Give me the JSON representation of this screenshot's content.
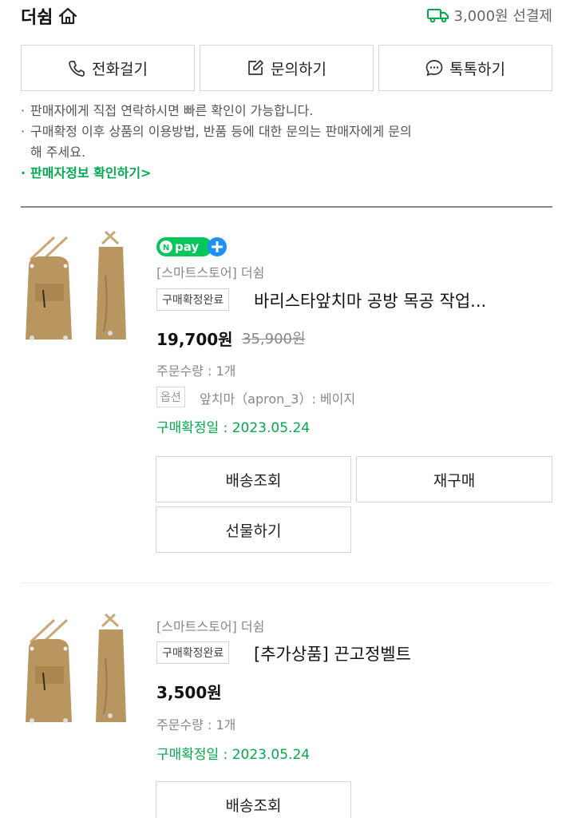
{
  "store": {
    "name": "더쉼",
    "shipping_text": "3,000원 선결제"
  },
  "contact": {
    "call_label": "전화걸기",
    "inquiry_label": "문의하기",
    "talk_label": "톡톡하기"
  },
  "notice": {
    "line1": "판매자에게 직접 연락하시면 빠른 확인이 가능합니다.",
    "line2a": "구매확정 이후 상품의 이용방법, 반품 등에 대한 문의는 판매자에게 문의",
    "line2b": "해 주세요.",
    "seller_info_link": "판매자정보 확인하기>"
  },
  "orders": [
    {
      "pay_badge": "Npay+",
      "store_tag": "[스마트스토어] 더쉼",
      "status": "구매확정완료",
      "title": "바리스타앞치마 공방 목공 작업...",
      "price": "19,700원",
      "original_price": "35,900원",
      "quantity": "주문수량 : 1개",
      "option_label": "옵션",
      "option_value": "앞치마（apron_3）: 베이지",
      "confirm_date": "구매확정일 : 2023.05.24",
      "buttons": {
        "track": "배송조회",
        "rebuy": "재구매",
        "gift": "선물하기"
      }
    },
    {
      "store_tag": "[스마트스토어] 더쉼",
      "status": "구매확정완료",
      "title": "[추가상품] 끈고정벨트",
      "price": "3,500원",
      "quantity": "주문수량 : 1개",
      "confirm_date": "구매확정일 : 2023.05.24",
      "buttons": {
        "track": "배송조회"
      }
    }
  ],
  "colors": {
    "accent_green": "#03a94e",
    "npay_blue": "#1e90ff",
    "apron_tan": "#b9955f"
  }
}
